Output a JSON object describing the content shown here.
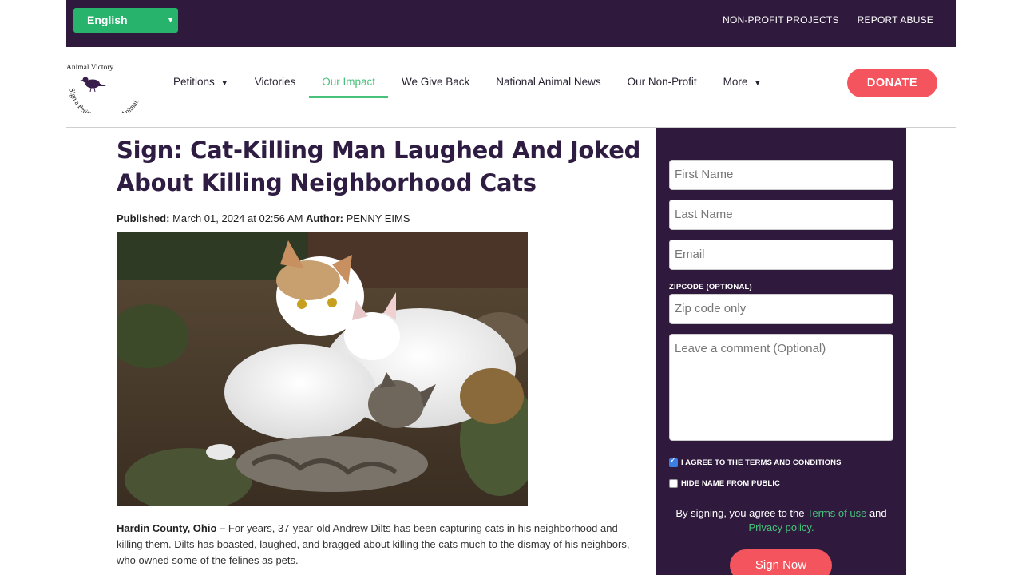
{
  "topbar": {
    "language": "English",
    "links": [
      "NON-PROFIT PROJECTS",
      "REPORT ABUSE"
    ]
  },
  "logo": {
    "name": "Animal Victory",
    "tagline": "Sign a Petition. Save an Animal."
  },
  "nav": {
    "items": [
      {
        "label": "Petitions",
        "dropdown": true
      },
      {
        "label": "Victories"
      },
      {
        "label": "Our Impact",
        "active": true
      },
      {
        "label": "We Give Back"
      },
      {
        "label": "National Animal News"
      },
      {
        "label": "Our Non-Profit"
      },
      {
        "label": "More",
        "dropdown": true
      }
    ],
    "donate_label": "DONATE"
  },
  "article": {
    "title": "Sign: Cat-Killing Man Laughed And Joked About Killing Neighborhood Cats",
    "published_label": "Published:",
    "published_value": "March 01, 2024 at 02:56 AM",
    "author_label": "Author:",
    "author_value": "PENNY EIMS",
    "dateline": "Hardin County, Ohio –",
    "body": "For years, 37-year-old Andrew Dilts has been capturing cats in his neighborhood and killing them. Dilts has boasted, laughed, and bragged about killing the cats much to the dismay of his neighbors, who owned some of the felines as pets."
  },
  "form": {
    "first_name_placeholder": "First Name",
    "last_name_placeholder": "Last Name",
    "email_placeholder": "Email",
    "zip_label": "ZIPCODE (OPTIONAL)",
    "zip_placeholder": "Zip code only",
    "comment_placeholder": "Leave a comment (Optional)",
    "agree_label": "I AGREE TO THE TERMS AND CONDITIONS",
    "agree_checked": true,
    "hide_label": "HIDE NAME FROM PUBLIC",
    "hide_checked": false,
    "consent_prefix": "By signing, you agree to the",
    "terms_link": "Terms of use",
    "consent_and": "and",
    "privacy_link": "Privacy policy.",
    "submit_label": "Sign Now"
  },
  "colors": {
    "brand_purple": "#2f1a3d",
    "accent_green": "#46c27a",
    "cta_red": "#f4545d",
    "lang_green": "#27b36b"
  }
}
